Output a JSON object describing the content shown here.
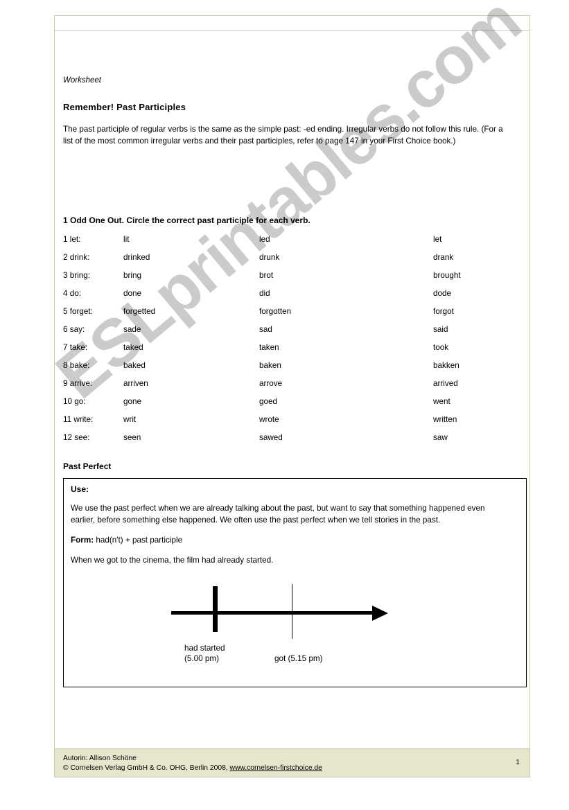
{
  "document": {
    "worksheet_label": "Worksheet",
    "section_title": "Remember! Past Participles",
    "intro_paragraph": "The past participle of regular verbs is the same as the simple past: -ed ending. Irregular verbs do not follow this rule. (For a list of the most common irregular verbs and their past participles, refer to page 147 in your First Choice book.)"
  },
  "exercise": {
    "heading": "1 Odd One Out. Circle the correct past participle for each verb.",
    "rows": [
      {
        "verb": "1 let:",
        "a": "lit",
        "b": "led",
        "c": "let"
      },
      {
        "verb": "2 drink:",
        "a": "drinked",
        "b": "drunk",
        "c": "drank"
      },
      {
        "verb": "3 bring:",
        "a": "bring",
        "b": "brot",
        "c": "brought"
      },
      {
        "verb": "4 do:",
        "a": "done",
        "b": "did",
        "c": "dode"
      },
      {
        "verb": "5 forget:",
        "a": "forgetted",
        "b": "forgotten",
        "c": "forgot"
      },
      {
        "verb": "6 say:",
        "a": "sade",
        "b": "sad",
        "c": "said"
      },
      {
        "verb": "7 take:",
        "a": "taked",
        "b": "taken",
        "c": "took"
      },
      {
        "verb": "8 bake:",
        "a": "baked",
        "b": "baken",
        "c": "bakken"
      },
      {
        "verb": "9 arrive:",
        "a": "arriven",
        "b": "arrove",
        "c": "arrived"
      },
      {
        "verb": "10 go:",
        "a": "gone",
        "b": "goed",
        "c": "went"
      },
      {
        "verb": "11 write:",
        "a": "writ",
        "b": "wrote",
        "c": "written"
      },
      {
        "verb": "12 see:",
        "a": "seen",
        "b": "sawed",
        "c": "saw"
      }
    ]
  },
  "past_perfect": {
    "title": "Past Perfect",
    "use_label": "Use:",
    "use_paragraph": "We use the past perfect when we are already talking about the past, but want to say that something happened even earlier, before something else happened. We often use the past perfect when we tell stories in the past.",
    "form_label": "Form:",
    "form_value": " had(n't) + past participle",
    "example": "When we got to the cinema, the film had already started.",
    "timeline": {
      "earlier_event_label": "had started\n(5.00 pm)",
      "later_event_label": "got (5.15 pm)"
    }
  },
  "footer": {
    "author_line": "Autorin: Allison Schöne",
    "copyright_prefix": "© Cornelsen Verlag GmbH & Co. OHG, Berlin 2008, ",
    "link_text": "www.cornelsen-firstchoice.de",
    "page_number": "1"
  },
  "watermark": {
    "text": "ESLprintables.com"
  }
}
